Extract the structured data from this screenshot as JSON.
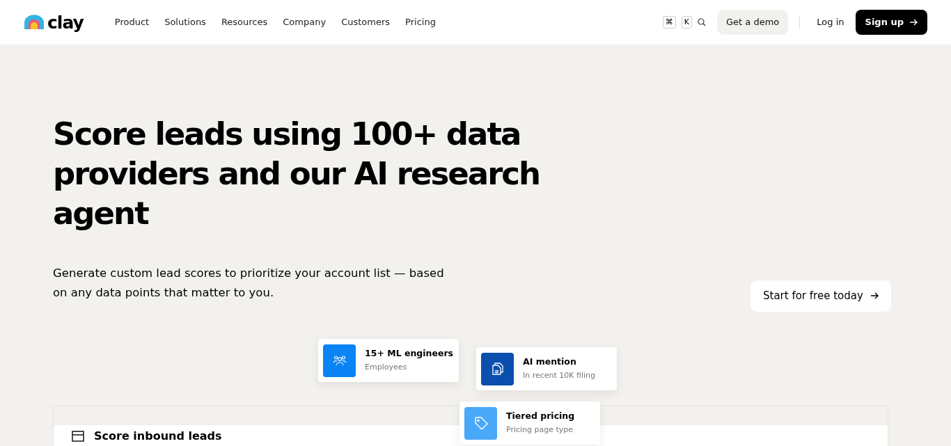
{
  "logo": {
    "text": "clay"
  },
  "nav": [
    {
      "label": "Product"
    },
    {
      "label": "Solutions"
    },
    {
      "label": "Resources"
    },
    {
      "label": "Company"
    },
    {
      "label": "Customers"
    },
    {
      "label": "Pricing"
    }
  ],
  "shortcut_keys": [
    "⌘",
    "K"
  ],
  "actions": {
    "demo": "Get a demo",
    "login": "Log in",
    "signup": "Sign up"
  },
  "hero": {
    "title": "Score leads using 100+ data providers and our AI research agent",
    "subtitle": "Generate custom lead scores to prioritize your account list — based on any data points that matter to you.",
    "cta": "Start for free today"
  },
  "cards": [
    {
      "kind": "people",
      "title": "15+ ML engineers",
      "subtitle": "Employees",
      "color": "#0a84f5"
    },
    {
      "kind": "document",
      "title": "AI mention",
      "subtitle": "In recent 10K filing",
      "color": "#0b4fae"
    },
    {
      "kind": "tag",
      "title": "Tiered pricing",
      "subtitle": "Pricing page type",
      "color": "#4aa8f8"
    }
  ],
  "panel": {
    "heading": "Score inbound leads"
  }
}
